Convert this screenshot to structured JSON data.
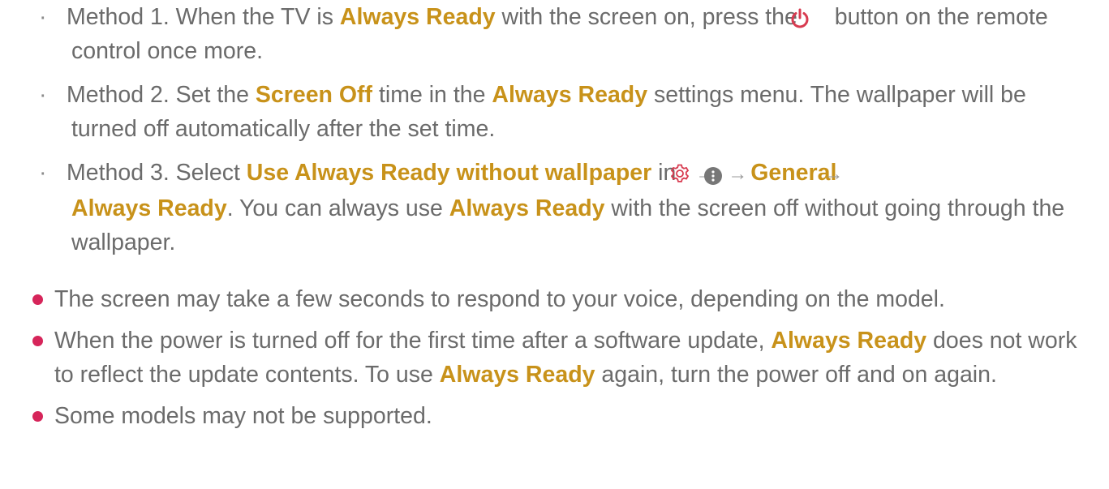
{
  "colors": {
    "text": "#6b6b6b",
    "highlight": "#c8921a",
    "accent": "#d83b50",
    "bullet": "#d6255a"
  },
  "sub_items": [
    {
      "prefix": "Method 1. When the TV is ",
      "hl1": "Always Ready",
      "mid1": " with the screen on, press the ",
      "icon": "power-icon",
      "suffix": " button on the remote control once more."
    },
    {
      "prefix": "Method 2. Set the ",
      "hl1": "Screen Off",
      "mid1": " time in the ",
      "hl2": "Always Ready",
      "suffix": " settings menu. The wallpaper will be turned off automatically after the set time."
    },
    {
      "prefix": "Method 3. Select ",
      "hl1": "Use Always Ready without wallpaper",
      "mid1": " in ",
      "icons": [
        "gear-icon",
        "arrow-icon",
        "more-icon",
        "arrow-icon"
      ],
      "hl2": "General",
      "hl3": "Always Ready",
      "mid2": ". You can always use ",
      "hl4": "Always Ready",
      "suffix": " with the screen off without going through the wallpaper."
    }
  ],
  "main_items": [
    {
      "text": "The screen may take a few seconds to respond to your voice, depending on the model."
    },
    {
      "prefix": "When the power is turned off for the first time after a software update, ",
      "hl1": "Always Ready",
      "mid1": " does not work to reflect the update contents. To use ",
      "hl2": "Always Ready",
      "suffix": " again, turn the power off and on again."
    },
    {
      "text": "Some models may not be supported."
    }
  ]
}
